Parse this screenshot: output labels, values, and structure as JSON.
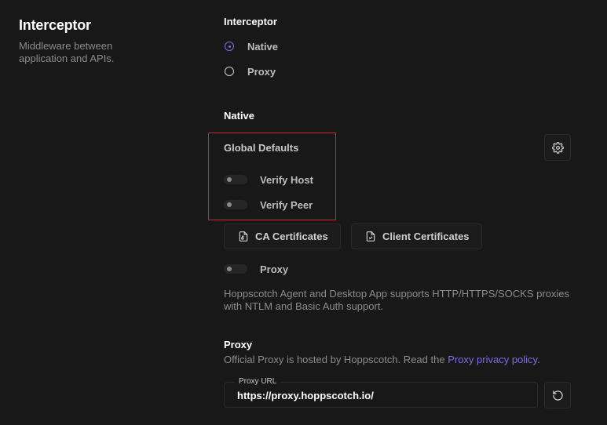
{
  "sidebar": {
    "title": "Interceptor",
    "description": "Middleware between application and APIs."
  },
  "interceptor": {
    "heading": "Interceptor",
    "options": [
      {
        "label": "Native",
        "selected": true
      },
      {
        "label": "Proxy",
        "selected": false
      }
    ]
  },
  "native": {
    "heading": "Native",
    "global_defaults": {
      "title": "Global Defaults",
      "toggles": [
        {
          "label": "Verify Host",
          "on": false
        },
        {
          "label": "Verify Peer",
          "on": false
        }
      ]
    },
    "buttons": {
      "ca_certificates": "CA Certificates",
      "client_certificates": "Client Certificates"
    },
    "proxy_toggle": {
      "label": "Proxy",
      "on": false
    },
    "proxy_note": "Hoppscotch Agent and Desktop App supports HTTP/HTTPS/SOCKS proxies with NTLM and Basic Auth support."
  },
  "proxy": {
    "heading": "Proxy",
    "description_prefix": "Official Proxy is hosted by Hoppscotch. Read the ",
    "link_text": "Proxy privacy policy",
    "description_suffix": ".",
    "url_label": "Proxy URL",
    "url_value": "https://proxy.hoppscotch.io/"
  },
  "colors": {
    "accent": "#7c6ee6",
    "highlight_border": "#d3262b",
    "background": "#181818"
  },
  "icons": {
    "settings": "gear-icon",
    "ca_cert": "file-key-icon",
    "client_cert": "file-check-icon",
    "reset": "rotate-ccw-icon"
  }
}
